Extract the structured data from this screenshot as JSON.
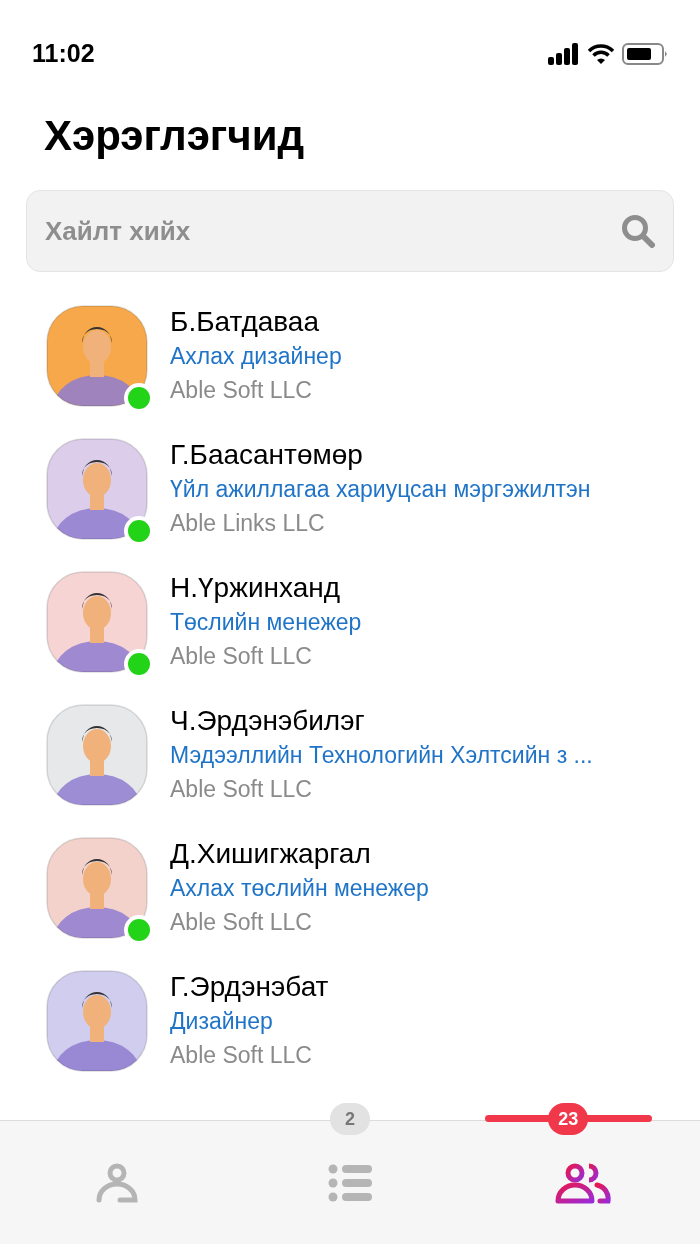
{
  "status_bar": {
    "time": "11:02"
  },
  "title": "Хэрэглэгчид",
  "search": {
    "placeholder": "Хайлт хийх"
  },
  "users": [
    {
      "name": "Б.Батдаваа",
      "role": "Ахлах дизайнер",
      "company": "Able Soft LLC",
      "online": true,
      "color": "#f6a84a"
    },
    {
      "name": "Г.Баасантөмөр",
      "role": "Үйл ажиллагаа хариуцсан мэргэжилтэн",
      "company": "Able Links LLC",
      "online": true,
      "color": "#dccdea"
    },
    {
      "name": "Н.Үржинханд",
      "role": "Төслийн менежер",
      "company": "Able Soft LLC",
      "online": true,
      "color": "#f6d4d4"
    },
    {
      "name": "Ч.Эрдэнэбилэг",
      "role": "Мэдээллийн Технологийн Хэлтсийн з ...",
      "company": "Able Soft LLC",
      "online": false,
      "color": "#e6e8ea"
    },
    {
      "name": "Д.Хишигжаргал",
      "role": "Ахлах төслийн менежер",
      "company": "Able Soft LLC",
      "online": true,
      "color": "#f4d2cc"
    },
    {
      "name": "Г.Эрдэнэбат",
      "role": "Дизайнер",
      "company": "Able Soft LLC",
      "online": false,
      "color": "#d0cdee"
    }
  ],
  "tabs": [
    {
      "kind": "person",
      "selected": false
    },
    {
      "kind": "list",
      "badge": "2",
      "selected": false
    },
    {
      "kind": "group",
      "badge": "23",
      "selected": true
    }
  ]
}
